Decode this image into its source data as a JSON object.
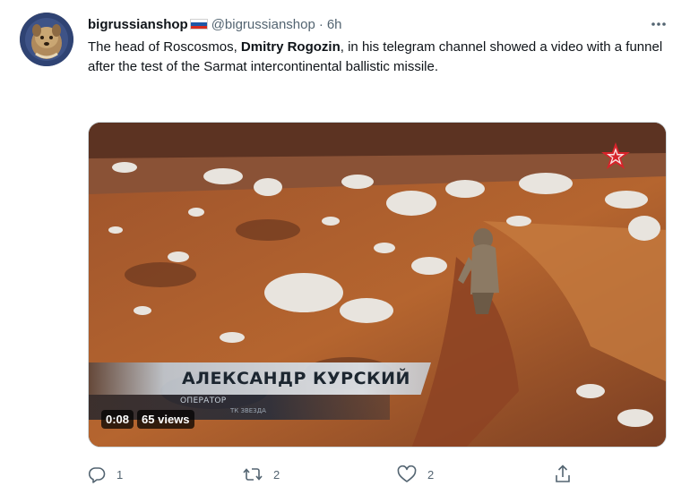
{
  "tweet": {
    "display_name": "bigrussianshop",
    "handle": "@bigrussianshop",
    "separator": "·",
    "time": "6h",
    "text_parts": {
      "before": "The head of Roscosmos, ",
      "bold": "Dmitry Rogozin",
      "after": ", in his telegram channel showed a video with a funnel after the test of the Sarmat intercontinental ballistic missile."
    }
  },
  "media": {
    "lower_third_name": "АЛЕКСАНДР КУРСКИЙ",
    "lower_third_role": "ОПЕРАТОР",
    "lower_third_sub": "ТК ЗВЕЗДА",
    "duration": "0:08",
    "views": "65 views"
  },
  "actions": {
    "reply_count": "1",
    "retweet_count": "2",
    "like_count": "2"
  },
  "icons": {
    "avatar": "avatar-image",
    "flag": "russia-flag-icon",
    "more": "more-icon",
    "watermark": "zvezda-star-icon",
    "reply": "reply-icon",
    "retweet": "retweet-icon",
    "like": "heart-icon",
    "share": "share-icon"
  },
  "colors": {
    "text_primary": "#0f1419",
    "text_secondary": "#536471",
    "flag_white": "#ffffff",
    "flag_blue": "#1c57a7",
    "flag_red": "#d52b1e"
  }
}
